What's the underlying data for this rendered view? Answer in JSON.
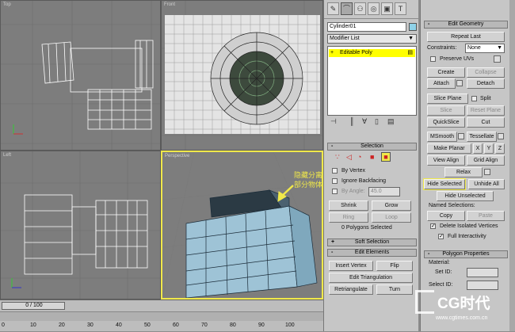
{
  "viewports": {
    "top": "Top",
    "front": "Front",
    "left": "Left",
    "perspective": "Perspective"
  },
  "tabs": [
    "arrow-icon",
    "curve-icon",
    "hierarchy-icon",
    "motion-icon",
    "display-icon",
    "utility-icon"
  ],
  "object_name": "Cylinder01",
  "modifier_list": "Modifier List",
  "stack_item": "Editable Poly",
  "selection": {
    "title": "Selection",
    "by_vertex": "By Vertex",
    "ignore_backfacing": "Ignore Backfacing",
    "by_angle": "By Angle:",
    "angle": "45.0",
    "shrink": "Shrink",
    "grow": "Grow",
    "ring": "Ring",
    "loop": "Loop",
    "status": "0 Polygons Selected"
  },
  "soft_selection": "Soft Selection",
  "edit_elements": {
    "title": "Edit Elements",
    "insert_vertex": "Insert Vertex",
    "flip": "Flip",
    "edit_triangulation": "Edit Triangulation",
    "retriangulate": "Retriangulate",
    "turn": "Turn"
  },
  "annotation": [
    "隐藏分离",
    "部分物体"
  ],
  "edit_geometry": {
    "title": "Edit Geometry",
    "repeat_last": "Repeat Last",
    "constraints": "Constraints:",
    "constraints_value": "None",
    "preserve_uvs": "Preserve UVs",
    "create": "Create",
    "collapse": "Collapse",
    "attach": "Attach",
    "detach": "Detach",
    "slice_plane": "Slice Plane",
    "split": "Split",
    "slice": "Slice",
    "reset_plane": "Reset Plane",
    "quickslice": "QuickSlice",
    "cut": "Cut",
    "msmooth": "MSmooth",
    "tessellate": "Tessellate",
    "make_planar": "Make Planar",
    "x": "X",
    "y": "Y",
    "z": "Z",
    "view_align": "View Align",
    "grid_align": "Grid Align",
    "relax": "Relax",
    "hide_selected": "Hide Selected",
    "unhide_all": "Unhide All",
    "hide_unselected": "Hide Unselected",
    "named_selections": "Named Selections:",
    "copy": "Copy",
    "paste": "Paste",
    "delete_isolated": "Delete Isolated Vertices",
    "full_interactivity": "Full Interactivity"
  },
  "polygon_props": {
    "title": "Polygon Properties",
    "material": "Material:",
    "set_id": "Set ID:",
    "select_id": "Select ID:"
  },
  "timeline": {
    "frame": "0 / 100",
    "ticks": [
      "0",
      "10",
      "20",
      "30",
      "40",
      "50",
      "60",
      "70",
      "80",
      "90",
      "100"
    ]
  },
  "watermark": {
    "brand": "CG时代",
    "url": "www.cgtimes.com.cn"
  },
  "colors": {
    "accent_yellow": "#f0e84a",
    "selection_yellow": "#ffff00",
    "viewport_bg": "#7d7d7d",
    "panel_bg": "#c6c6c6"
  }
}
